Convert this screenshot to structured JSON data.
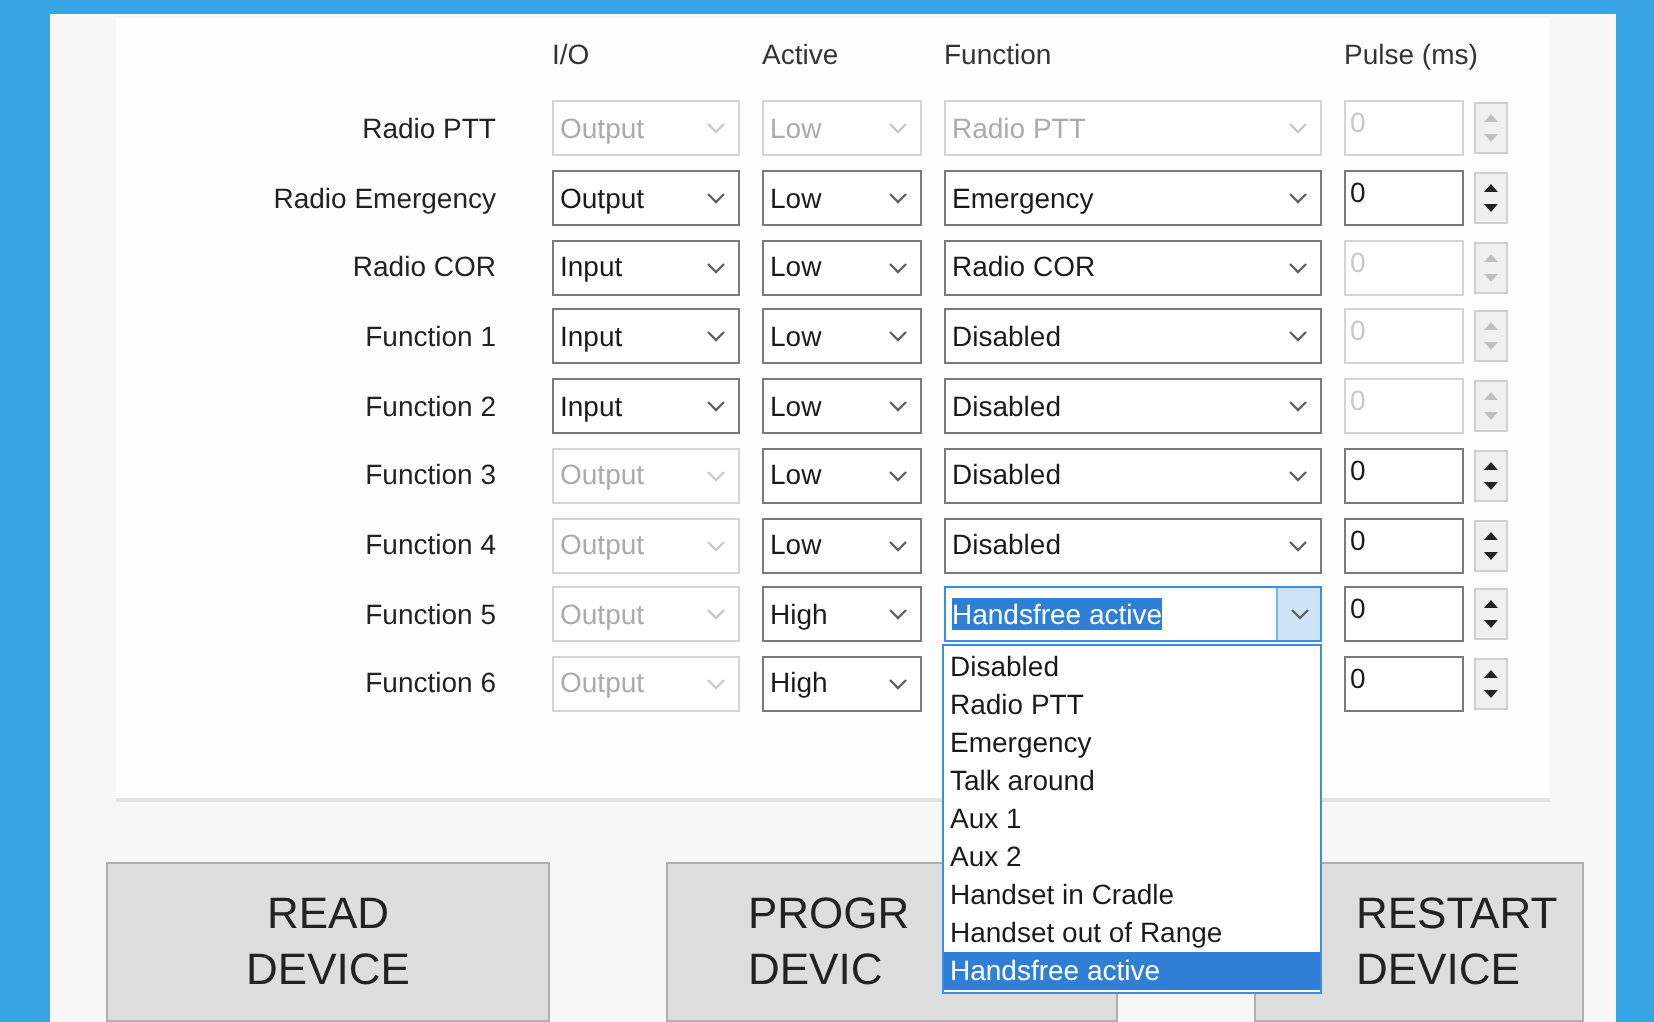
{
  "columns": [
    "I/O",
    "Active",
    "Function",
    "Pulse (ms)"
  ],
  "rows": [
    {
      "label": "Radio PTT",
      "io": {
        "value": "Output",
        "disabled": true
      },
      "active": {
        "value": "Low",
        "disabled": true
      },
      "function": {
        "value": "Radio PTT",
        "disabled": true,
        "open": false
      },
      "pulse": {
        "value": "0",
        "disabled": true
      }
    },
    {
      "label": "Radio Emergency",
      "io": {
        "value": "Output",
        "disabled": false
      },
      "active": {
        "value": "Low",
        "disabled": false
      },
      "function": {
        "value": "Emergency",
        "disabled": false,
        "open": false
      },
      "pulse": {
        "value": "0",
        "disabled": false
      }
    },
    {
      "label": "Radio COR",
      "io": {
        "value": "Input",
        "disabled": false
      },
      "active": {
        "value": "Low",
        "disabled": false
      },
      "function": {
        "value": "Radio COR",
        "disabled": false,
        "open": false
      },
      "pulse": {
        "value": "0",
        "disabled": true
      }
    },
    {
      "label": "Function 1",
      "io": {
        "value": "Input",
        "disabled": false
      },
      "active": {
        "value": "Low",
        "disabled": false
      },
      "function": {
        "value": "Disabled",
        "disabled": false,
        "open": false
      },
      "pulse": {
        "value": "0",
        "disabled": true
      }
    },
    {
      "label": "Function 2",
      "io": {
        "value": "Input",
        "disabled": false
      },
      "active": {
        "value": "Low",
        "disabled": false
      },
      "function": {
        "value": "Disabled",
        "disabled": false,
        "open": false
      },
      "pulse": {
        "value": "0",
        "disabled": true
      }
    },
    {
      "label": "Function 3",
      "io": {
        "value": "Output",
        "disabled": true
      },
      "active": {
        "value": "Low",
        "disabled": false
      },
      "function": {
        "value": "Disabled",
        "disabled": false,
        "open": false
      },
      "pulse": {
        "value": "0",
        "disabled": false
      }
    },
    {
      "label": "Function 4",
      "io": {
        "value": "Output",
        "disabled": true
      },
      "active": {
        "value": "Low",
        "disabled": false
      },
      "function": {
        "value": "Disabled",
        "disabled": false,
        "open": false
      },
      "pulse": {
        "value": "0",
        "disabled": false
      }
    },
    {
      "label": "Function 5",
      "io": {
        "value": "Output",
        "disabled": true
      },
      "active": {
        "value": "High",
        "disabled": false
      },
      "function": {
        "value": "Handsfree active",
        "disabled": false,
        "open": true
      },
      "pulse": {
        "value": "0",
        "disabled": false
      }
    },
    {
      "label": "Function 6",
      "io": {
        "value": "Output",
        "disabled": true
      },
      "active": {
        "value": "High",
        "disabled": false
      },
      "pulse": {
        "value": "0",
        "disabled": false
      }
    }
  ],
  "dropdown": [
    {
      "label": "Disabled",
      "selected": false
    },
    {
      "label": "Radio PTT",
      "selected": false
    },
    {
      "label": "Emergency",
      "selected": false
    },
    {
      "label": "Talk around",
      "selected": false
    },
    {
      "label": "Aux 1",
      "selected": false
    },
    {
      "label": "Aux 2",
      "selected": false
    },
    {
      "label": "Handset in Cradle",
      "selected": false
    },
    {
      "label": "Handset out of Range",
      "selected": false
    },
    {
      "label": "Handsfree active",
      "selected": true
    }
  ],
  "buttons": [
    {
      "lines": [
        "READ",
        "DEVICE"
      ]
    },
    {
      "lines": [
        "PROGR",
        "DEVIC"
      ]
    },
    {
      "lines": [
        "RESTART",
        "DEVICE"
      ]
    }
  ]
}
